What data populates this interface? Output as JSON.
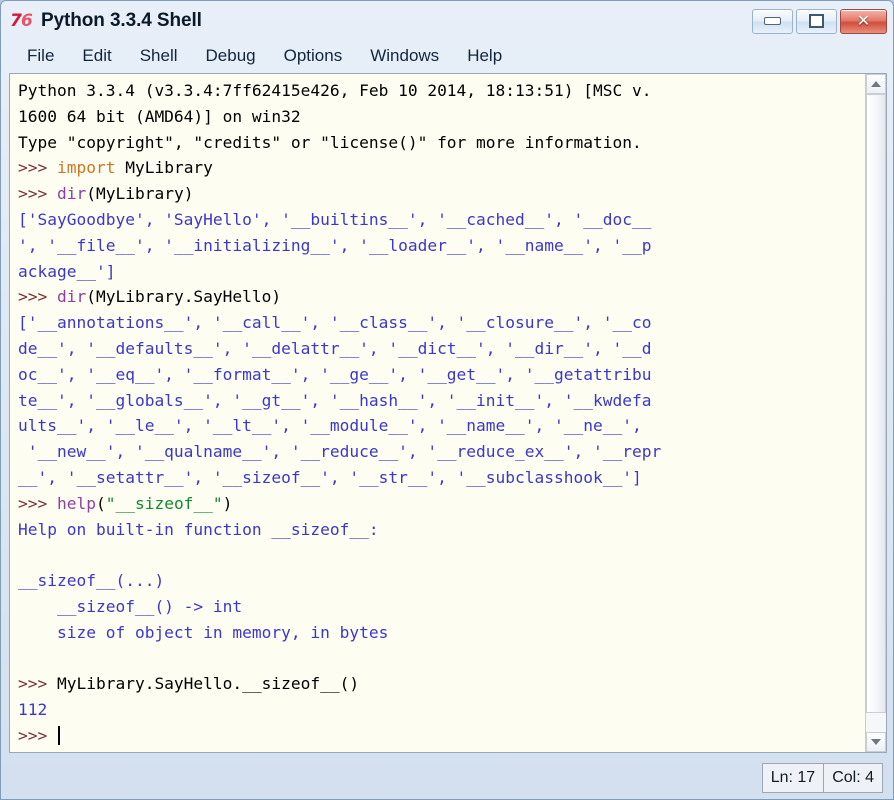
{
  "window": {
    "title": "Python 3.3.4 Shell",
    "icon": "python-idle-icon",
    "icon_glyph_left": "7",
    "icon_glyph_right": "6",
    "controls": {
      "minimize": "minimize",
      "maximize": "maximize",
      "close": "✕"
    }
  },
  "menubar": {
    "items": [
      {
        "label": "File"
      },
      {
        "label": "Edit"
      },
      {
        "label": "Shell"
      },
      {
        "label": "Debug"
      },
      {
        "label": "Options"
      },
      {
        "label": "Windows"
      },
      {
        "label": "Help"
      }
    ]
  },
  "shell": {
    "lines": [
      {
        "id": "l1",
        "segments": [
          {
            "text": "Python 3.3.4 (v3.3.4:7ff62415e426, Feb 10 2014, 18:13:51) [MSC v.",
            "style": "normal"
          }
        ]
      },
      {
        "id": "l2",
        "segments": [
          {
            "text": "1600 64 bit (AMD64)] on win32",
            "style": "normal"
          }
        ]
      },
      {
        "id": "l3",
        "segments": [
          {
            "text": "Type \"copyright\", \"credits\" or \"license()\" for more information.",
            "style": "normal"
          }
        ]
      },
      {
        "id": "l4",
        "segments": [
          {
            "text": ">>> ",
            "style": "prompt"
          },
          {
            "text": "import",
            "style": "keyword"
          },
          {
            "text": " MyLibrary",
            "style": "normal"
          }
        ]
      },
      {
        "id": "l5",
        "segments": [
          {
            "text": ">>> ",
            "style": "prompt"
          },
          {
            "text": "dir",
            "style": "builtin"
          },
          {
            "text": "(MyLibrary)",
            "style": "normal"
          }
        ]
      },
      {
        "id": "l6",
        "segments": [
          {
            "text": "['SayGoodbye', 'SayHello', '__builtins__', '__cached__', '__doc__",
            "style": "stdout"
          }
        ]
      },
      {
        "id": "l7",
        "segments": [
          {
            "text": "', '__file__', '__initializing__', '__loader__', '__name__', '__p",
            "style": "stdout"
          }
        ]
      },
      {
        "id": "l8",
        "segments": [
          {
            "text": "ackage__']",
            "style": "stdout"
          }
        ]
      },
      {
        "id": "l9",
        "segments": [
          {
            "text": ">>> ",
            "style": "prompt"
          },
          {
            "text": "dir",
            "style": "builtin"
          },
          {
            "text": "(MyLibrary.SayHello)",
            "style": "normal"
          }
        ]
      },
      {
        "id": "l10",
        "segments": [
          {
            "text": "['__annotations__', '__call__', '__class__', '__closure__', '__co",
            "style": "stdout"
          }
        ]
      },
      {
        "id": "l11",
        "segments": [
          {
            "text": "de__', '__defaults__', '__delattr__', '__dict__', '__dir__', '__d",
            "style": "stdout"
          }
        ]
      },
      {
        "id": "l12",
        "segments": [
          {
            "text": "oc__', '__eq__', '__format__', '__ge__', '__get__', '__getattribu",
            "style": "stdout"
          }
        ]
      },
      {
        "id": "l13",
        "segments": [
          {
            "text": "te__', '__globals__', '__gt__', '__hash__', '__init__', '__kwdefa",
            "style": "stdout"
          }
        ]
      },
      {
        "id": "l14",
        "segments": [
          {
            "text": "ults__', '__le__', '__lt__', '__module__', '__name__', '__ne__',",
            "style": "stdout"
          }
        ]
      },
      {
        "id": "l15",
        "segments": [
          {
            "text": " '__new__', '__qualname__', '__reduce__', '__reduce_ex__', '__repr",
            "style": "stdout"
          }
        ]
      },
      {
        "id": "l16",
        "segments": [
          {
            "text": "__', '__setattr__', '__sizeof__', '__str__', '__subclasshook__']",
            "style": "stdout"
          }
        ]
      },
      {
        "id": "l17",
        "segments": [
          {
            "text": ">>> ",
            "style": "prompt"
          },
          {
            "text": "help",
            "style": "builtin"
          },
          {
            "text": "(",
            "style": "normal"
          },
          {
            "text": "\"__sizeof__\"",
            "style": "string"
          },
          {
            "text": ")",
            "style": "normal"
          }
        ]
      },
      {
        "id": "l18",
        "segments": [
          {
            "text": "Help on built-in function __sizeof__:",
            "style": "stdout"
          }
        ]
      },
      {
        "id": "l19",
        "segments": [
          {
            "text": "",
            "style": "stdout"
          }
        ]
      },
      {
        "id": "l20",
        "segments": [
          {
            "text": "__sizeof__(...)",
            "style": "stdout"
          }
        ]
      },
      {
        "id": "l21",
        "segments": [
          {
            "text": "    __sizeof__() -> int",
            "style": "stdout"
          }
        ]
      },
      {
        "id": "l22",
        "segments": [
          {
            "text": "    size of object in memory, in bytes",
            "style": "stdout"
          }
        ]
      },
      {
        "id": "l23",
        "segments": [
          {
            "text": "",
            "style": "stdout"
          }
        ]
      },
      {
        "id": "l24",
        "segments": [
          {
            "text": ">>> ",
            "style": "prompt"
          },
          {
            "text": "MyLibrary.SayHello.__sizeof__()",
            "style": "normal"
          }
        ]
      },
      {
        "id": "l25",
        "segments": [
          {
            "text": "112",
            "style": "stdout"
          }
        ]
      },
      {
        "id": "l26",
        "segments": [
          {
            "text": ">>> ",
            "style": "prompt"
          },
          {
            "text": "",
            "style": "normal",
            "cursor": true
          }
        ]
      }
    ]
  },
  "scrollbar": {
    "up_arrow": "scroll-up",
    "down_arrow": "scroll-down",
    "thumb_top_percent": 0,
    "thumb_height_percent": 97
  },
  "statusbar": {
    "line_label": "Ln: 17",
    "col_label": "Col: 4"
  },
  "colors": {
    "normal": "#000000",
    "stdout": "#3b38c8",
    "prompt": "#7a3030",
    "builtin": "#8f3fa0",
    "keyword": "#cc7722",
    "string": "#128a2e",
    "background": "#fdfdf2",
    "chrome": "#dde8f4"
  }
}
